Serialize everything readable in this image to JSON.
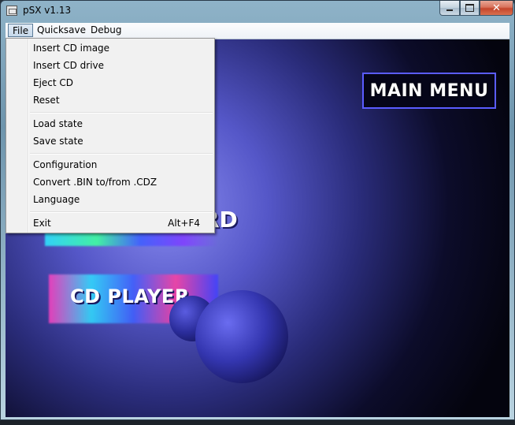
{
  "window": {
    "title": "pSX v1.13"
  },
  "menubar": {
    "items": [
      "File",
      "Quicksave",
      "Debug"
    ]
  },
  "file_menu": {
    "items": [
      {
        "label": "Insert CD image"
      },
      {
        "label": "Insert CD drive"
      },
      {
        "label": "Eject CD"
      },
      {
        "label": "Reset"
      },
      {
        "label": "Load state"
      },
      {
        "label": "Save state"
      },
      {
        "label": "Configuration"
      },
      {
        "label": "Convert .BIN to/from .CDZ"
      },
      {
        "label": "Language"
      },
      {
        "label": "Exit",
        "shortcut": "Alt+F4"
      }
    ]
  },
  "game_screen": {
    "main_menu_label": "MAIN MENU",
    "memory_card_label": "RD",
    "cd_player_label": "CD PLAYER"
  },
  "colors": {
    "menu_highlight_border": "#5b7b98",
    "main_menu_border": "#5a5cff",
    "background_glow": "#8a8cf0"
  }
}
